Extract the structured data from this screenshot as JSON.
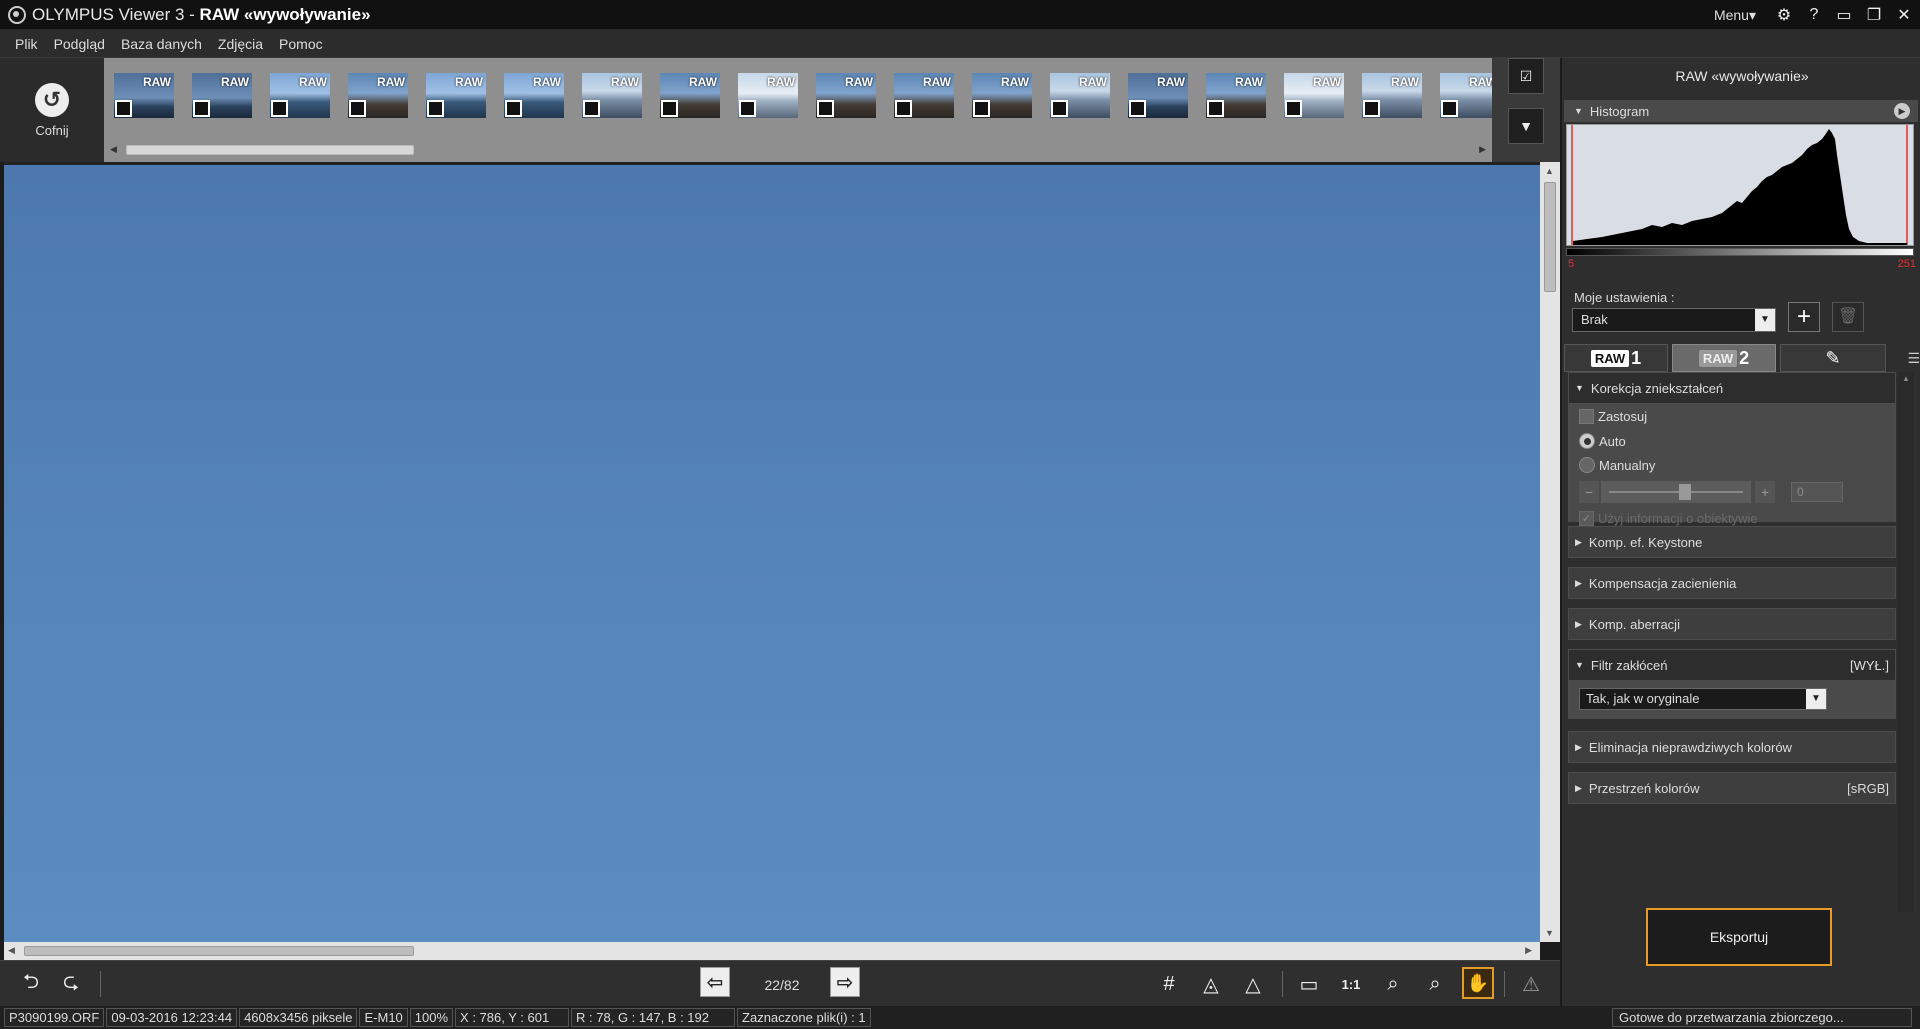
{
  "window": {
    "title_app": "OLYMPUS Viewer 3 - ",
    "title_mode": "RAW «wywoływanie»",
    "menu_label": "Menu▾"
  },
  "menubar": {
    "items": [
      "Plik",
      "Podgląd",
      "Baza danych",
      "Zdjęcia",
      "Pomoc"
    ]
  },
  "strip": {
    "undo_label": "Cofnij",
    "thumb_badge": "RAW",
    "thumb_count": 18
  },
  "navigation": {
    "counter": "22/82"
  },
  "status": {
    "filename": "P3090199.ORF",
    "datetime": "09-03-2016 12:23:44",
    "dimensions": "4608x3456 piksele",
    "camera": "E-M10",
    "zoom": "100%",
    "coords": "X : 786, Y : 601",
    "rgb": "R : 78, G : 147, B : 192",
    "selected": "Zaznaczone plik(i) : 1",
    "ready": "Gotowe do przetwarzania zbiorczego..."
  },
  "panel": {
    "title": "RAW «wywoływanie»",
    "histogram": {
      "label": "Histogram",
      "min": "5",
      "max": "251"
    },
    "presets": {
      "label": "Moje ustawienia :",
      "value": "Brak"
    },
    "tabs": {
      "raw_badge": "RAW",
      "tab1_num": "1",
      "tab2_num": "2"
    },
    "distortion": {
      "title": "Korekcja zniekształceń",
      "apply": "Zastosuj",
      "auto": "Auto",
      "manual": "Manualny",
      "value": "0",
      "use_lens": "Użyj informacji o obiektywie"
    },
    "keystone": {
      "title": "Komp. ef. Keystone"
    },
    "shading": {
      "title": "Kompensacja zacienienia"
    },
    "aberration": {
      "title": "Komp. aberracji"
    },
    "noise": {
      "title": "Filtr zakłóceń",
      "value": "[WYŁ.]",
      "option": "Tak, jak w oryginale"
    },
    "false_color": {
      "title": "Eliminacja nieprawdziwych kolorów"
    },
    "color_space": {
      "title": "Przestrzeń kolorów",
      "value": "[sRGB]"
    },
    "export_label": "Eksportuj"
  },
  "colors": {
    "accent": "#e89a28",
    "sky": "#5584ba",
    "clip": "#e03030"
  }
}
